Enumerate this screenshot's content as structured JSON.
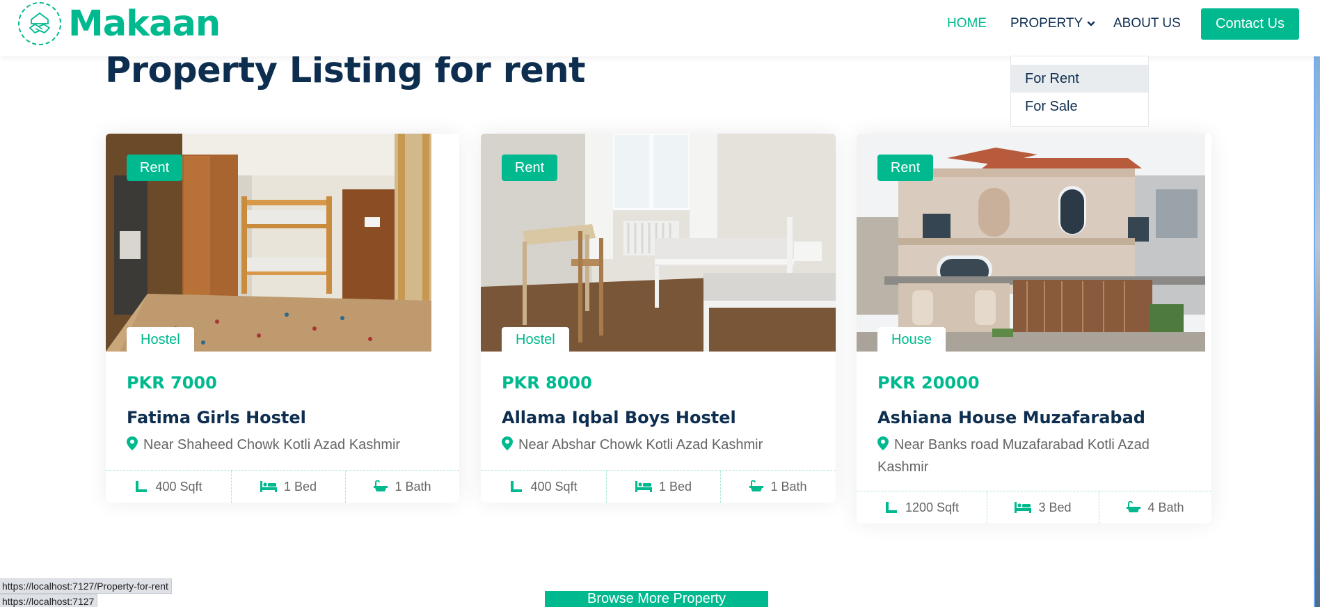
{
  "brand": {
    "name": "Makaan",
    "logo_icon": "handshake-house-icon"
  },
  "nav": {
    "home": "HOME",
    "property": "PROPERTY",
    "about": "ABOUT US",
    "contact": "Contact Us",
    "dropdown": [
      "For Rent",
      "For Sale"
    ]
  },
  "page": {
    "title": "Property Listing for rent"
  },
  "listings": [
    {
      "status": "Rent",
      "type": "Hostel",
      "price": "PKR 7000",
      "name": "Fatima Girls Hostel",
      "address": "Near Shaheed Chowk Kotli Azad Kashmir",
      "area": "400 Sqft",
      "beds": "1 Bed",
      "baths": "1 Bath"
    },
    {
      "status": "Rent",
      "type": "Hostel",
      "price": "PKR 8000",
      "name": "Allama Iqbal Boys Hostel",
      "address": "Near Abshar Chowk Kotli Azad Kashmir",
      "area": "400 Sqft",
      "beds": "1 Bed",
      "baths": "1 Bath"
    },
    {
      "status": "Rent",
      "type": "House",
      "price": "PKR 20000",
      "name": "Ashiana House Muzafarabad",
      "address": "Near Banks road Muzafarabad Kotli Azad Kashmir",
      "area": "1200 Sqft",
      "beds": "3 Bed",
      "baths": "4 Bath"
    }
  ],
  "browse_button": "Browse More Property",
  "status_bar": {
    "link_preview": "https://localhost:7127/Property-for-rent",
    "origin": "https://localhost:7127"
  },
  "colors": {
    "accent": "#00b98e",
    "heading": "#0e2e50",
    "muted": "#666565"
  }
}
